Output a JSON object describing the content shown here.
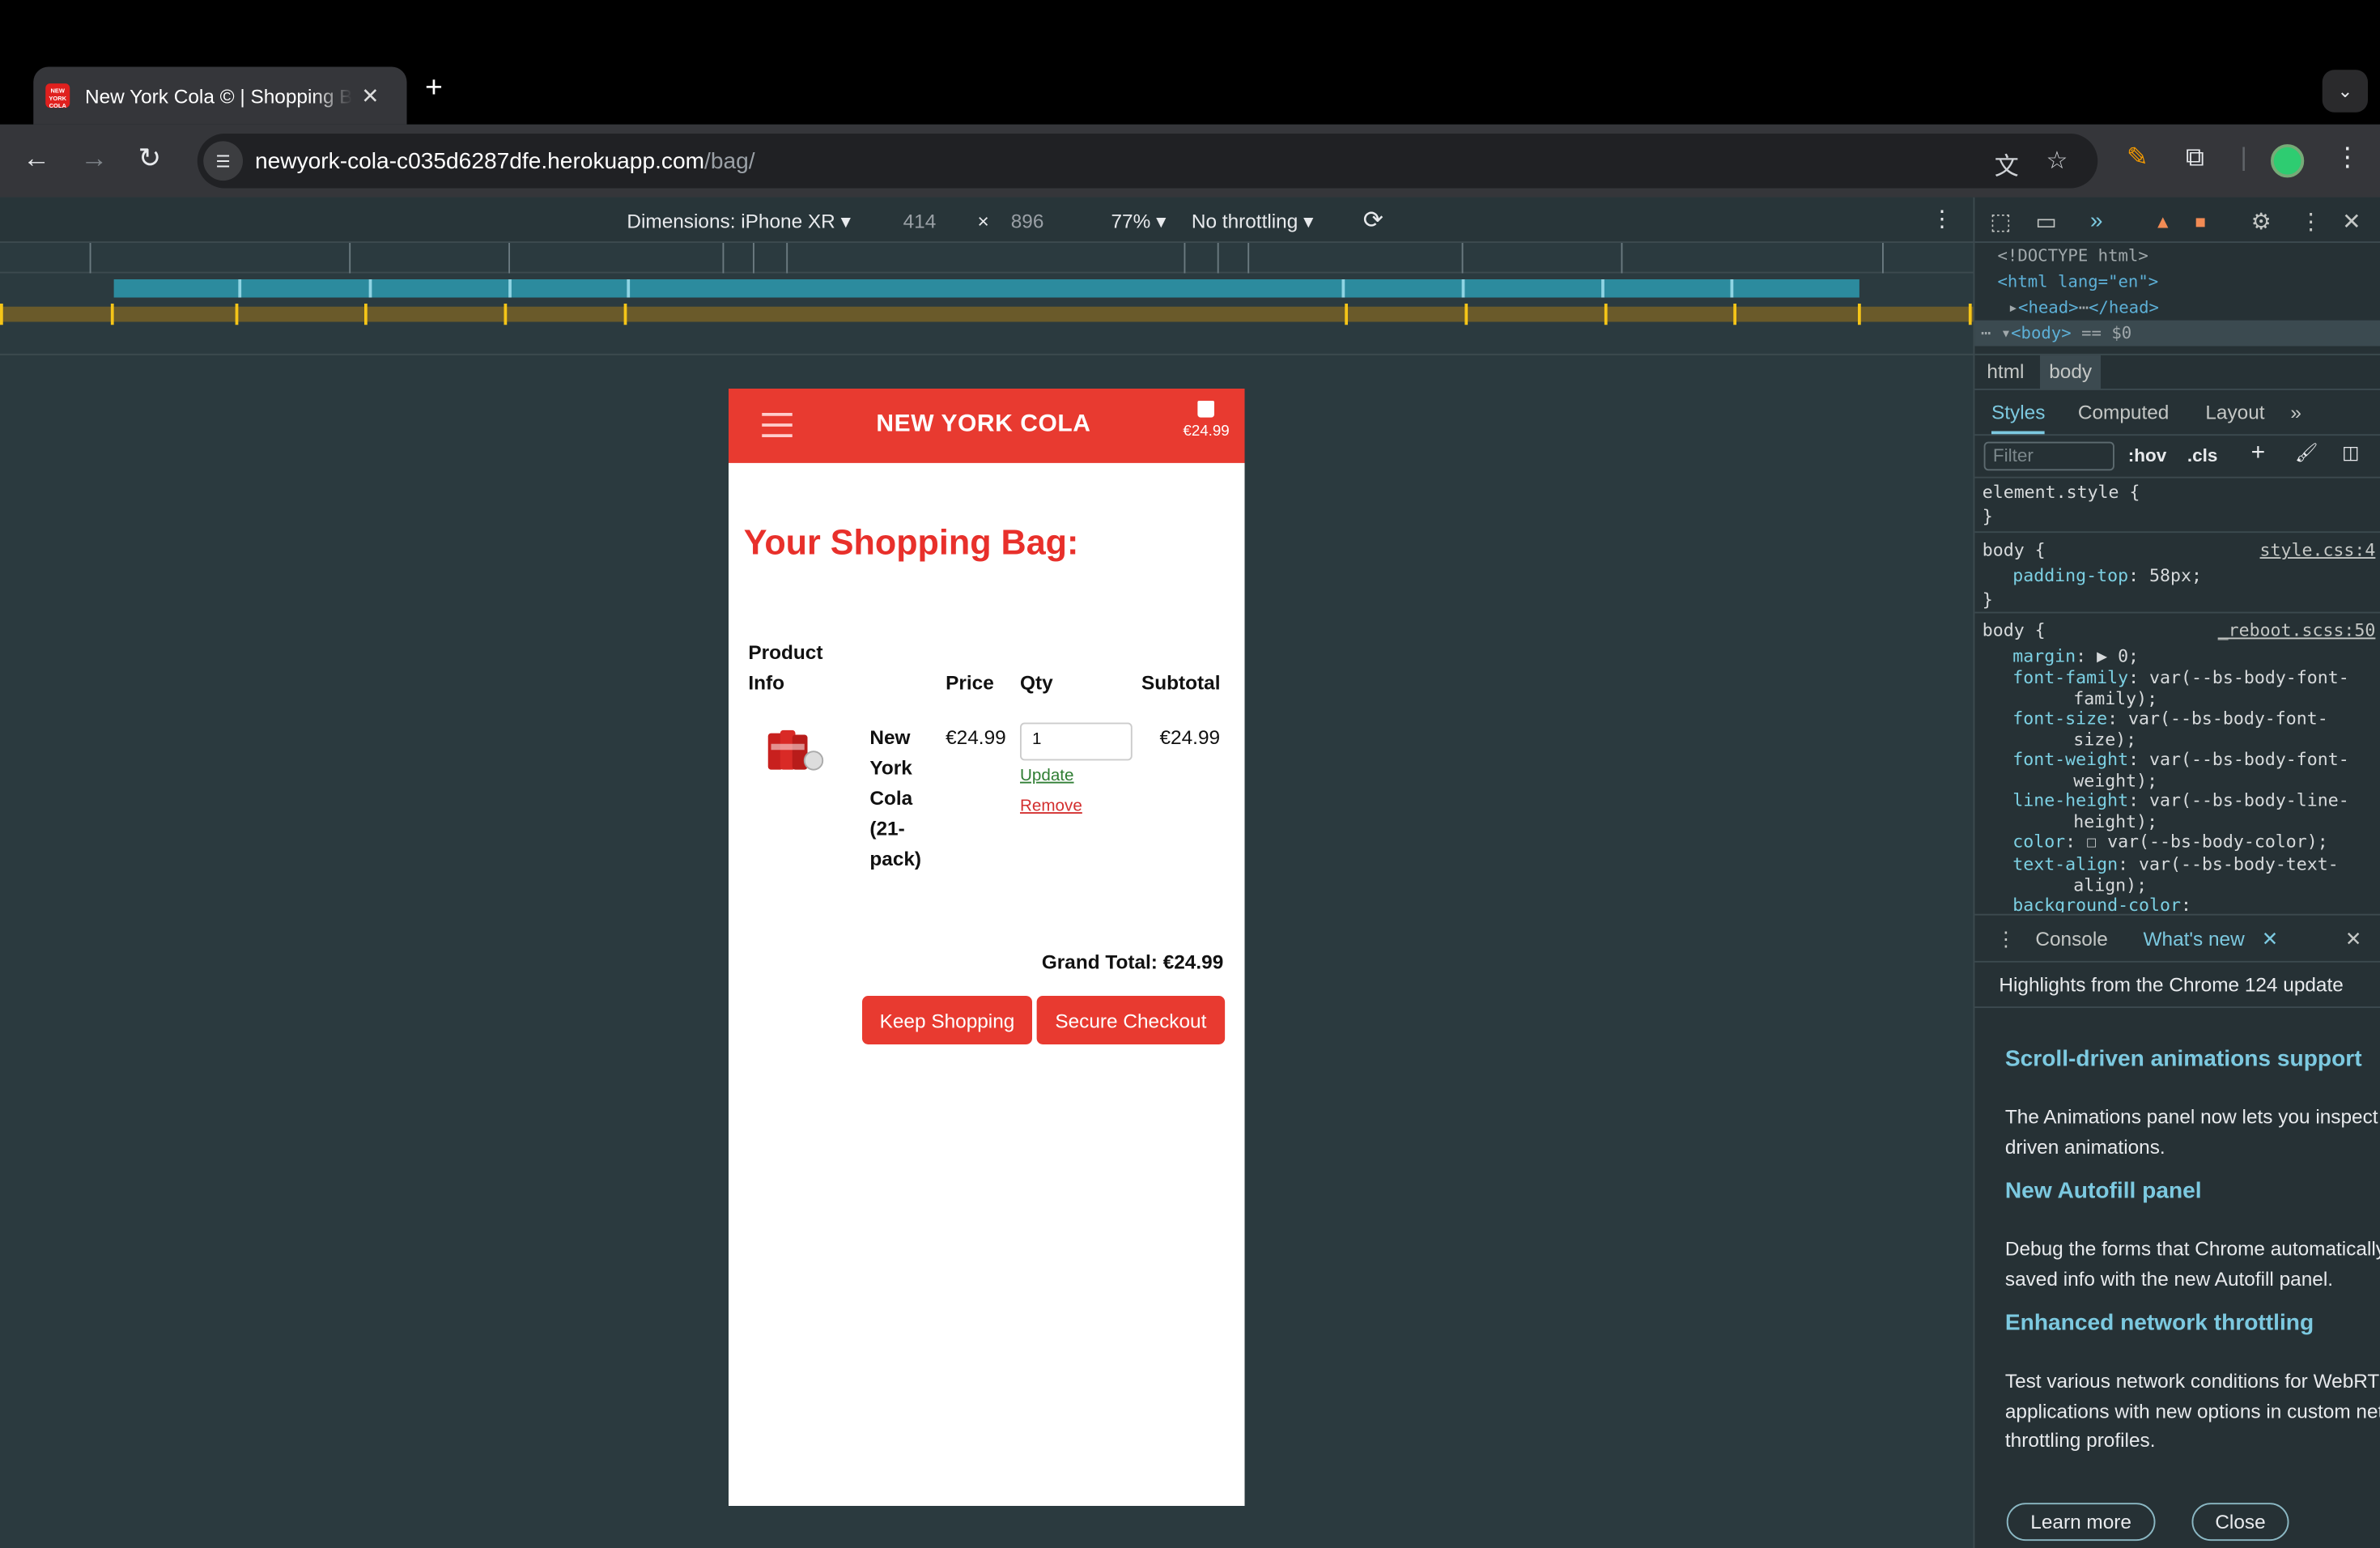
{
  "browser": {
    "tab_title": "New York Cola © | Shopping Bag",
    "favicon_text": "NEW YORK COLA",
    "url_host": "newyork-cola-c035d6287dfe.herokuapp.com",
    "url_path": "/bag/"
  },
  "device_toolbar": {
    "dimensions_label": "Dimensions: iPhone XR",
    "width": "414",
    "times": "×",
    "height": "896",
    "zoom": "77%",
    "throttling": "No throttling"
  },
  "site": {
    "brand": "NEW YORK COLA",
    "bag_total": "€24.99",
    "page_heading": "Your Shopping Bag:",
    "table": {
      "headers": {
        "product_line1": "Product",
        "product_line2": "Info",
        "price": "Price",
        "qty": "Qty",
        "subtotal": "Subtotal"
      },
      "rows": [
        {
          "name_lines": [
            "New",
            "York",
            "Cola",
            "(21-",
            "pack)"
          ],
          "price": "€24.99",
          "qty": "1",
          "update": "Update",
          "remove": "Remove",
          "subtotal": "€24.99"
        }
      ]
    },
    "grand_total": "Grand Total: €24.99",
    "keep_shopping": "Keep Shopping",
    "secure_checkout": "Secure Checkout"
  },
  "devtools": {
    "dom": {
      "doctype": "<!DOCTYPE html>",
      "html_open": "<html lang=\"en\">",
      "head": "<head>",
      "head_close": "</head>",
      "body": "<body>",
      "body_sel": "== $0"
    },
    "crumbs": [
      "html",
      "body"
    ],
    "tabs": [
      "Styles",
      "Computed",
      "Layout"
    ],
    "filter_placeholder": "Filter",
    "hov": ":hov",
    "cls": ".cls",
    "css": {
      "element_style": "element.style {",
      "close": "}",
      "body1_sel": "body {",
      "body1_src": "style.css:4",
      "body1_prop": "padding-top",
      "body1_val": ": 58px;",
      "body2_sel": "body {",
      "body2_src": "_reboot.scss:50",
      "margin": "margin",
      "margin_val": ": ▶ 0;",
      "ff": "font-family",
      "ff_val": ": var(--bs-body-font-",
      "ff_val2": "family);",
      "fs": "font-size",
      "fs_val": ": var(--bs-body-font-",
      "fs_val2": "size);",
      "fw": "font-weight",
      "fw_val": ": var(--bs-body-font-",
      "fw_val2": "weight);",
      "lh": "line-height",
      "lh_val": ": var(--bs-body-line-",
      "lh_val2": "height);",
      "color": "color",
      "color_val": ": ☐ var(--bs-body-color);",
      "ta": "text-align",
      "ta_val": ": var(--bs-body-text-",
      "ta_val2": "align);",
      "bg": "background-color",
      "bg_val": ":"
    },
    "drawer": {
      "console": "Console",
      "whats_new": "What's new",
      "banner": "Highlights from the Chrome 124 update",
      "items": [
        {
          "title": "Scroll-driven animations support",
          "body": "The Animations panel now lets you inspect scroll-\ndriven animations."
        },
        {
          "title": "New Autofill panel",
          "body": "Debug the forms that Chrome automatically fills with\nsaved info with the new Autofill panel."
        },
        {
          "title": "Enhanced network throttling",
          "body": "Test various network conditions for WebRTC\napplications with new options in custom network\nthrottling profiles."
        }
      ],
      "learn_more": "Learn more",
      "close": "Close"
    }
  }
}
